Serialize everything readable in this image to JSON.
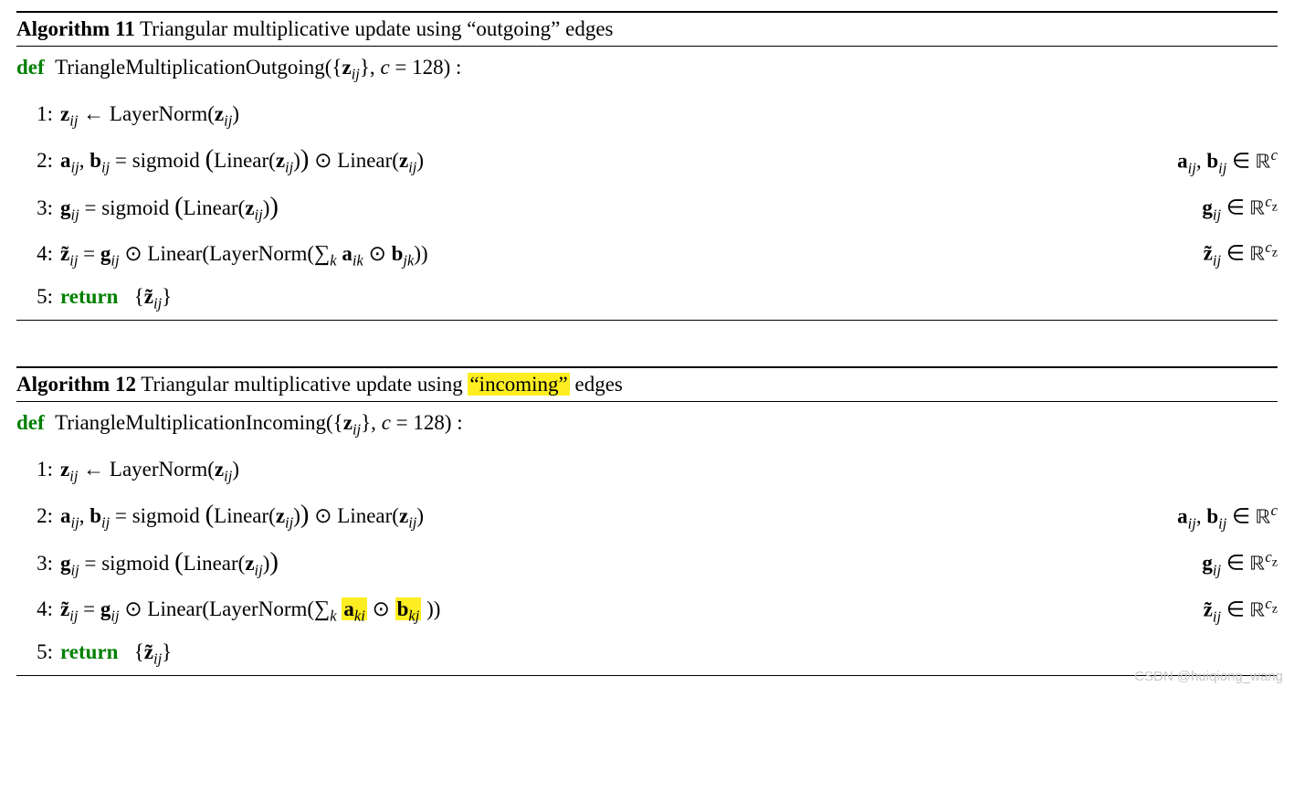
{
  "algo1": {
    "number": "Algorithm 11",
    "title": " Triangular multiplicative update using “outgoing” edges",
    "def_kw": "def",
    "def_sig": "TriangleMultiplicationOutgoing",
    "def_args_open": "({",
    "def_z": "z",
    "def_z_sub": "ij",
    "def_args_mid": "}, ",
    "def_c": "c",
    "def_args_close": " = 128) :",
    "lines": {
      "l1": {
        "no": "1:"
      },
      "l2": {
        "no": "2:"
      },
      "l3": {
        "no": "3:"
      },
      "l4": {
        "no": "4:"
      },
      "l5": {
        "no": "5:"
      }
    },
    "ret_kw": "return",
    "sum_a_sub": "ik",
    "sum_b_sub": "jk"
  },
  "algo2": {
    "number": "Algorithm 12",
    "title_pre": " Triangular multiplicative update using ",
    "title_hl": "“incoming”",
    "title_post": " edges",
    "def_kw": "def",
    "def_sig": "TriangleMultiplicationIncoming",
    "def_args_open": "({",
    "def_z": "z",
    "def_z_sub": "ij",
    "def_args_mid": "}, ",
    "def_c": "c",
    "def_args_close": " = 128) :",
    "lines": {
      "l1": {
        "no": "1:"
      },
      "l2": {
        "no": "2:"
      },
      "l3": {
        "no": "3:"
      },
      "l4": {
        "no": "4:"
      },
      "l5": {
        "no": "5:"
      }
    },
    "ret_kw": "return",
    "sum_a_sub": "ki",
    "sum_b_sub": "kj"
  },
  "text": {
    "layernorm": "LayerNorm",
    "linear": "Linear",
    "sigmoid": "sigmoid",
    "arrow": " ← ",
    "eq": " = ",
    "odot": " ⊙ ",
    "sum": "∑",
    "sum_sub": "k",
    "in": " ∈ ",
    "R": "ℝ",
    "comma": ", ",
    "lparen": "(",
    "rparen": ")",
    "big_lparen": "(",
    "big_rparen": ")",
    "lbrace": "{",
    "rbrace": "}",
    "space": "   "
  },
  "vars": {
    "z": "z",
    "ztilde": "z̃",
    "a": "a",
    "b": "b",
    "g": "g",
    "ij": "ij",
    "c": "c",
    "cz": "c",
    "cz_sub": "z"
  },
  "watermark": "CSDN @huiqiong_wang"
}
